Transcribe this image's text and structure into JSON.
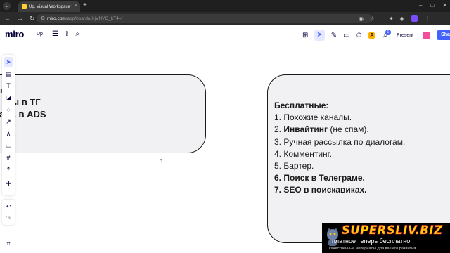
{
  "browser": {
    "tab_title": "Up. Visual Workspace for Inno",
    "tab_close": "×",
    "new_tab": "+",
    "url_main": "miro.com",
    "url_path": "/app/board/uXjVNYO_kT4=/"
  },
  "miro": {
    "logo": "miro",
    "board_name": "Up",
    "present_label": "Present",
    "share_label": "Share",
    "avatar_initial": "A",
    "notification_count": "1"
  },
  "canvas": {
    "left_card": {
      "lines": [
        "ые:",
        "вы в ТГ",
        "ама в ADS"
      ]
    },
    "right_card": {
      "heading": "Бесплатные:",
      "items": [
        {
          "num": "1.",
          "bold": "",
          "text": "Похожие каналы.",
          "all_bold": false
        },
        {
          "num": "2.",
          "bold": "Инвайтинг",
          "text": " (не спам).",
          "all_bold": false
        },
        {
          "num": "3.",
          "bold": "",
          "text": "Ручная рассылка по диалогам.",
          "all_bold": false
        },
        {
          "num": "4.",
          "bold": "",
          "text": "Комментинг.",
          "all_bold": false
        },
        {
          "num": "5.",
          "bold": "",
          "text": "Бартер.",
          "all_bold": false
        },
        {
          "num": "6.",
          "bold": "Поиск в Телеграме.",
          "text": "",
          "all_bold": true
        },
        {
          "num": "7.",
          "bold": "SEO в поискавиках.",
          "text": "",
          "all_bold": true
        }
      ]
    }
  },
  "watermark": {
    "brand": "SUPERSLIV.BIZ",
    "tagline": "платное теперь бесплатно",
    "subline": "качественные материалы для вашего развития"
  },
  "colors": {
    "accent": "#4262ff",
    "card_fill": "#f1f1f3",
    "card_border": "#1a1a1a",
    "watermark_yellow": "#ffd400"
  }
}
